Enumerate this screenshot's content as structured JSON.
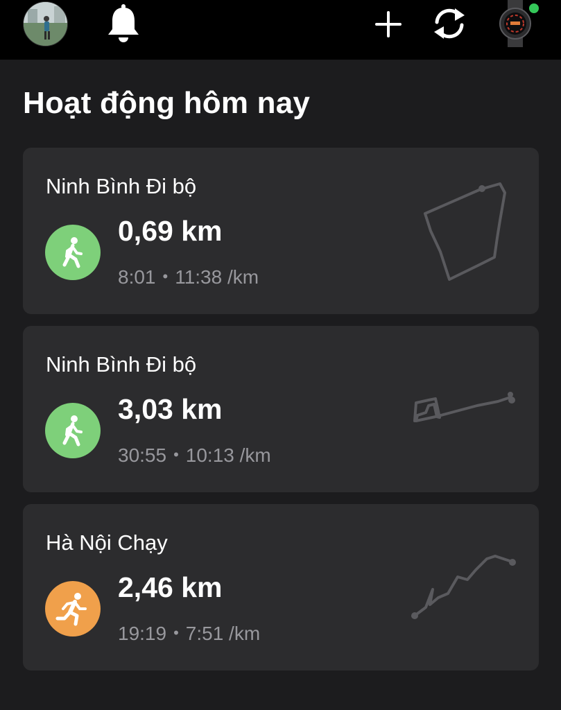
{
  "header": {
    "avatar_icon": "profile-photo",
    "notification_icon": "bell-icon",
    "add_icon": "plus-icon",
    "sync_icon": "sync-icon",
    "device_icon": "smartwatch-icon",
    "device_status_color": "#34c759"
  },
  "page": {
    "title": "Hoạt động hôm nay"
  },
  "colors": {
    "background": "#1c1c1e",
    "card": "#2c2c2e",
    "walk": "#7ed07a",
    "run": "#f0a04b",
    "secondary_text": "#98989d",
    "route_line": "#5a5a5e"
  },
  "activities": [
    {
      "name": "Ninh Bình Đi bộ",
      "type": "walking",
      "icon": "walking-person-icon",
      "distance": "0,69 km",
      "duration": "8:01",
      "pace": "11:38 /km",
      "separator": "•"
    },
    {
      "name": "Ninh Bình Đi bộ",
      "type": "walking",
      "icon": "walking-person-icon",
      "distance": "3,03 km",
      "duration": "30:55",
      "pace": "10:13 /km",
      "separator": "•"
    },
    {
      "name": "Hà Nội Chạy",
      "type": "running",
      "icon": "running-person-icon",
      "distance": "2,46 km",
      "duration": "19:19",
      "pace": "7:51 /km",
      "separator": "•"
    }
  ]
}
